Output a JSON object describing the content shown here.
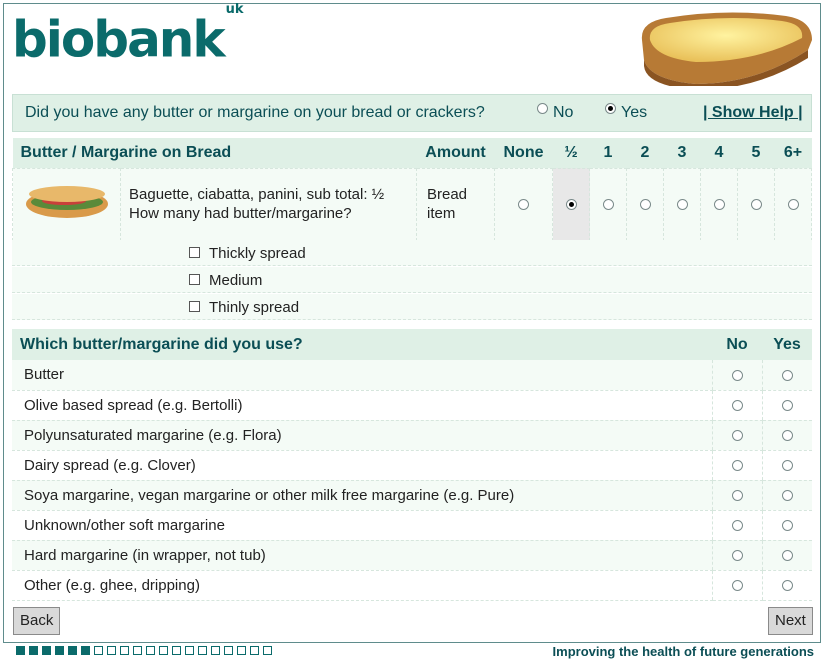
{
  "brand": {
    "name": "biobank",
    "suffix": "uk"
  },
  "question": {
    "text": "Did you have any butter or margarine on your bread or crackers?",
    "options": [
      {
        "label": "No",
        "selected": false
      },
      {
        "label": "Yes",
        "selected": true
      }
    ],
    "help_label": "| Show Help |"
  },
  "bread_table": {
    "headers": {
      "title": "Butter / Margarine on Bread",
      "amount": "Amount",
      "amounts": [
        "None",
        "½",
        "1",
        "2",
        "3",
        "4",
        "5",
        "6+"
      ]
    },
    "row": {
      "description": "Baguette, ciabatta, panini, sub total: ½ How many had butter/margarine?",
      "unit": "Bread item",
      "selected_index": 1
    }
  },
  "spread_options": [
    {
      "label": "Thickly spread",
      "checked": false
    },
    {
      "label": "Medium",
      "checked": false
    },
    {
      "label": "Thinly spread",
      "checked": false
    }
  ],
  "types_table": {
    "header": "Which butter/margarine did you use?",
    "col_no": "No",
    "col_yes": "Yes",
    "rows": [
      "Butter",
      "Olive based spread (e.g. Bertolli)",
      "Polyunsaturated margarine (e.g. Flora)",
      "Dairy spread (e.g. Clover)",
      "Soya margarine, vegan margarine or other milk free margarine (e.g. Pure)",
      "Unknown/other soft margarine",
      "Hard margarine (in wrapper, not tub)",
      "Other (e.g. ghee, dripping)"
    ]
  },
  "nav": {
    "back": "Back",
    "next": "Next"
  },
  "progress": {
    "completed": 6,
    "total": 20
  },
  "tagline": "Improving the health of future generations",
  "colors": {
    "brand": "#0b6b6b",
    "header_bg": "#dff0e6",
    "row_alt": "#f4fbf6"
  }
}
